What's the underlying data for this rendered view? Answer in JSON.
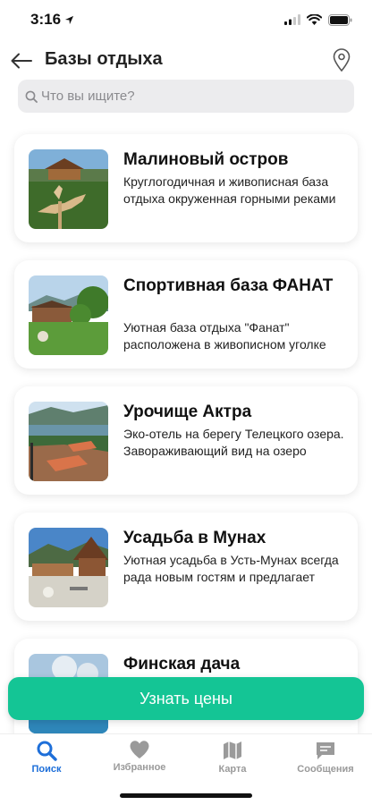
{
  "status_bar": {
    "time": "3:16"
  },
  "header": {
    "title": "Базы отдыха"
  },
  "search": {
    "placeholder": "Что вы ищите?"
  },
  "places": [
    {
      "title": "Малиновый остров",
      "description": "Круглогодичная и живописная база отдыха окруженная горными реками"
    },
    {
      "title": "Спортивная база ФАНАТ",
      "description": "Уютная база отдыха \"Фанат\" расположена в живописном уголке"
    },
    {
      "title": "Урочище Актра",
      "description": "Эко-отель на берегу Телецкого озера. Завораживающий вид на озеро"
    },
    {
      "title": "Усадьба в Мунах",
      "description": "Уютная усадьба в Усть-Мунах всегда рада новым гостям и предлагает"
    },
    {
      "title": "Финская дача",
      "description": ""
    }
  ],
  "cta": {
    "label": "Узнать цены"
  },
  "tabs": [
    {
      "label": "Поиск",
      "icon": "search-icon",
      "active": true
    },
    {
      "label": "Избранное",
      "icon": "heart-icon",
      "active": false
    },
    {
      "label": "Карта",
      "icon": "map-icon",
      "active": false
    },
    {
      "label": "Сообщения",
      "icon": "chat-icon",
      "active": false
    }
  ],
  "colors": {
    "accent": "#14c595",
    "active_tab": "#1e6fd9",
    "inactive_tab": "#9a9a9a"
  }
}
